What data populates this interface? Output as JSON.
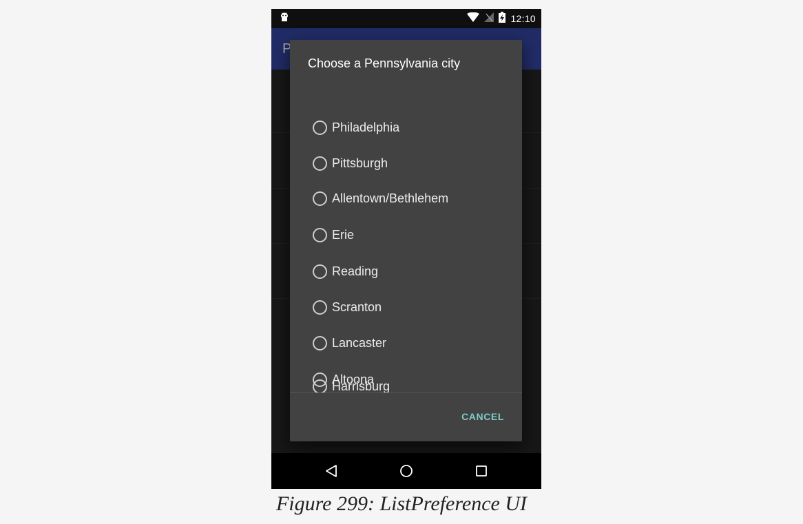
{
  "status_bar": {
    "time": "12:10",
    "icons": [
      "android-debug-icon",
      "wifi-icon",
      "no-signal-icon",
      "battery-charging-icon"
    ]
  },
  "app_bar": {
    "title": "P"
  },
  "dialog": {
    "title": "Choose a Pennsylvania city",
    "options": [
      {
        "label": "Philadelphia",
        "selected": false
      },
      {
        "label": "Pittsburgh",
        "selected": false
      },
      {
        "label": "Allentown/Bethlehem",
        "selected": false
      },
      {
        "label": "Erie",
        "selected": false
      },
      {
        "label": "Reading",
        "selected": false
      },
      {
        "label": "Scranton",
        "selected": false
      },
      {
        "label": "Lancaster",
        "selected": false
      },
      {
        "label": "Altoona",
        "selected": false
      },
      {
        "label": "Harrisburg",
        "selected": false
      }
    ],
    "cancel_label": "CANCEL",
    "accent_color": "#7fcbc4"
  },
  "nav_bar": {
    "buttons": [
      "back-icon",
      "home-icon",
      "recents-icon"
    ]
  },
  "caption": "Figure 299: ListPreference UI",
  "colors": {
    "app_bar": "#2e3e8f",
    "dialog_bg": "#424242",
    "page_bg": "#f5f5f5"
  }
}
